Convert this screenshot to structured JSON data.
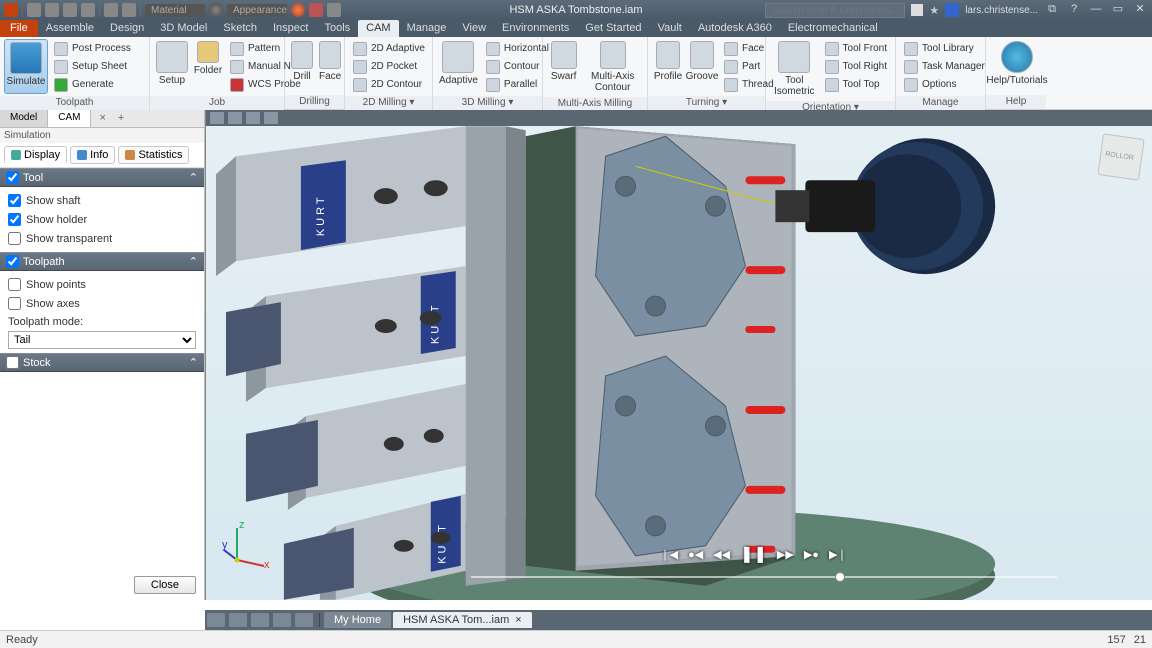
{
  "title": "HSM ASKA Tombstone.iam",
  "search_placeholder": "Search Help & Commands...",
  "user": "lars.christense...",
  "qat_dropdowns": {
    "material": "Material",
    "appearance": "Appearance"
  },
  "menu": {
    "file": "File",
    "tabs": [
      "Assemble",
      "Design",
      "3D Model",
      "Sketch",
      "Inspect",
      "Tools",
      "CAM",
      "Manage",
      "View",
      "Environments",
      "Get Started",
      "Vault",
      "Autodesk A360",
      "Electromechanical"
    ],
    "active": "CAM"
  },
  "ribbon": {
    "toolpath": {
      "label": "Toolpath",
      "big": "Simulate",
      "items": [
        "Post Process",
        "Setup Sheet",
        "Generate"
      ]
    },
    "job": {
      "label": "Job",
      "big1": "Setup",
      "big2": "Folder",
      "items": [
        "Pattern",
        "Manual NC",
        "WCS Probe"
      ]
    },
    "drilling": {
      "label": "Drilling",
      "big1": "Drill",
      "big2": "Face"
    },
    "mill2d": {
      "label": "2D Milling ▾",
      "items": [
        "2D Adaptive",
        "2D Pocket",
        "2D Contour"
      ]
    },
    "mill3d": {
      "label": "3D Milling ▾",
      "big": "Adaptive",
      "items": [
        "Horizontal",
        "Contour",
        "Parallel"
      ]
    },
    "multiaxis": {
      "label": "Multi-Axis Milling",
      "big1": "Swarf",
      "big2": "Multi-Axis Contour"
    },
    "turning": {
      "label": "Turning ▾",
      "big1": "Profile",
      "big2": "Groove",
      "items": [
        "Face",
        "Part",
        "Thread"
      ]
    },
    "orientation": {
      "label": "Orientation ▾",
      "big": "Tool Isometric",
      "items": [
        "Tool Front",
        "Tool Right",
        "Tool Top"
      ]
    },
    "manage": {
      "label": "Manage",
      "items": [
        "Tool Library",
        "Task Manager",
        "Options"
      ]
    },
    "help": {
      "label": "Help",
      "big": "Help/Tutorials"
    }
  },
  "panel": {
    "tabs": {
      "model": "Model",
      "cam": "CAM"
    },
    "header": "Simulation",
    "subtabs": {
      "display": "Display",
      "info": "Info",
      "stats": "Statistics"
    },
    "tool": {
      "hdr": "Tool",
      "shaft": "Show shaft",
      "holder": "Show holder",
      "transparent": "Show transparent"
    },
    "toolpath": {
      "hdr": "Toolpath",
      "points": "Show points",
      "axes": "Show axes",
      "mode_label": "Toolpath mode:",
      "mode_value": "Tail"
    },
    "stock": {
      "hdr": "Stock"
    },
    "close": "Close"
  },
  "playback": {
    "first": "❘◀",
    "stepb": "●◀",
    "rew": "◀◀",
    "play": "❚❚",
    "fwd": "▶▶",
    "stepf": "▶●",
    "last": "▶❘"
  },
  "doctabs": {
    "home": "My Home",
    "active": "HSM ASKA Tom...iam"
  },
  "status": {
    "ready": "Ready",
    "n1": "157",
    "n2": "21"
  },
  "viewcube": "ROLLOR",
  "triad": {
    "x": "x",
    "y": "y",
    "z": "z"
  }
}
